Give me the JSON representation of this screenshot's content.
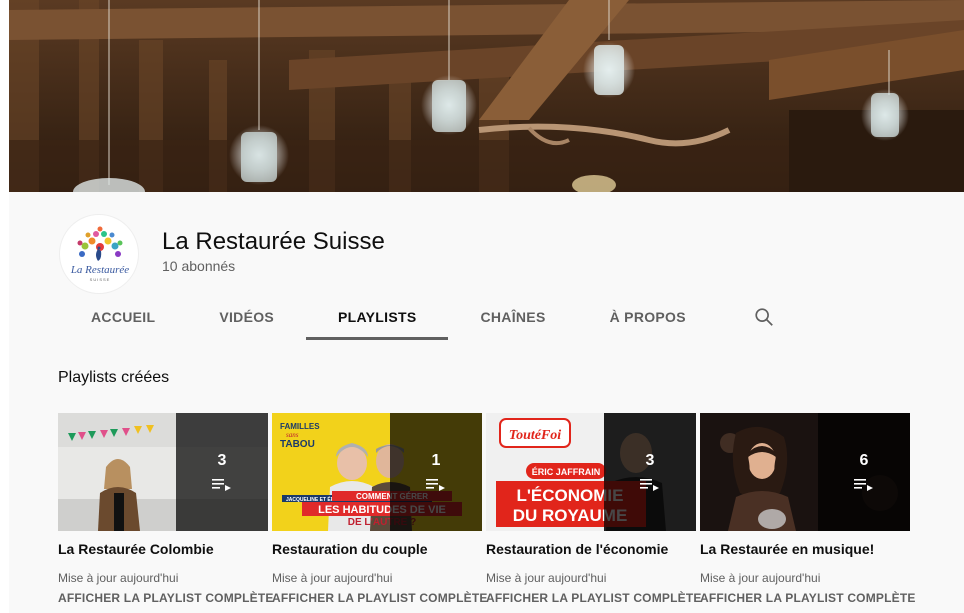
{
  "channel": {
    "name": "La Restaurée Suisse",
    "subscribers": "10 abonnés",
    "avatar_text": "La Restaurée",
    "avatar_subtext": "SUISSE"
  },
  "tabs": [
    {
      "label": "ACCUEIL",
      "active": false
    },
    {
      "label": "VIDÉOS",
      "active": false
    },
    {
      "label": "PLAYLISTS",
      "active": true
    },
    {
      "label": "CHAÎNES",
      "active": false
    },
    {
      "label": "À PROPOS",
      "active": false
    }
  ],
  "section": {
    "title": "Playlists créées"
  },
  "playlists": [
    {
      "title": "La Restaurée Colombie",
      "count": "3",
      "updated": "Mise à jour aujourd'hui",
      "link": "AFFICHER LA PLAYLIST COMPLÈTE"
    },
    {
      "title": "Restauration du couple",
      "count": "1",
      "updated": "Mise à jour aujourd'hui",
      "link": "AFFICHER LA PLAYLIST COMPLÈTE",
      "thumb_text": {
        "brand_line1": "FAMILLES",
        "brand_line2": "sans",
        "brand_line3": "TABOU",
        "names": "JACQUELINE ET ÉRIC JAFFRAIN",
        "headline1": "COMMENT GÉRER",
        "headline2": "LES HABITUDES DE VIE",
        "headline3": "DE L'AUTRE ?"
      }
    },
    {
      "title": "Restauration de l'économie",
      "count": "3",
      "updated": "Mise à jour aujourd'hui",
      "link": "AFFICHER LA PLAYLIST COMPLÈTE",
      "thumb_text": {
        "brand": "ToutéFoi",
        "name": "ÉRIC JAFFRAIN",
        "headline1": "L'ÉCONOMIE",
        "prefix": "DU",
        "headline2": "DU ROYAUME"
      }
    },
    {
      "title": "La Restaurée en musique!",
      "count": "6",
      "updated": "Mise à jour aujourd'hui",
      "link": "AFFICHER LA PLAYLIST COMPLÈTE"
    }
  ],
  "colors": {
    "background": "#f9f9f9",
    "text_primary": "#0f0f0f",
    "text_secondary": "#606060",
    "overlay": "#000000b8",
    "toutefoi_red": "#e1251b",
    "familles_yellow": "#f2d21b"
  },
  "icons": [
    "search-icon",
    "playlist-icon"
  ]
}
